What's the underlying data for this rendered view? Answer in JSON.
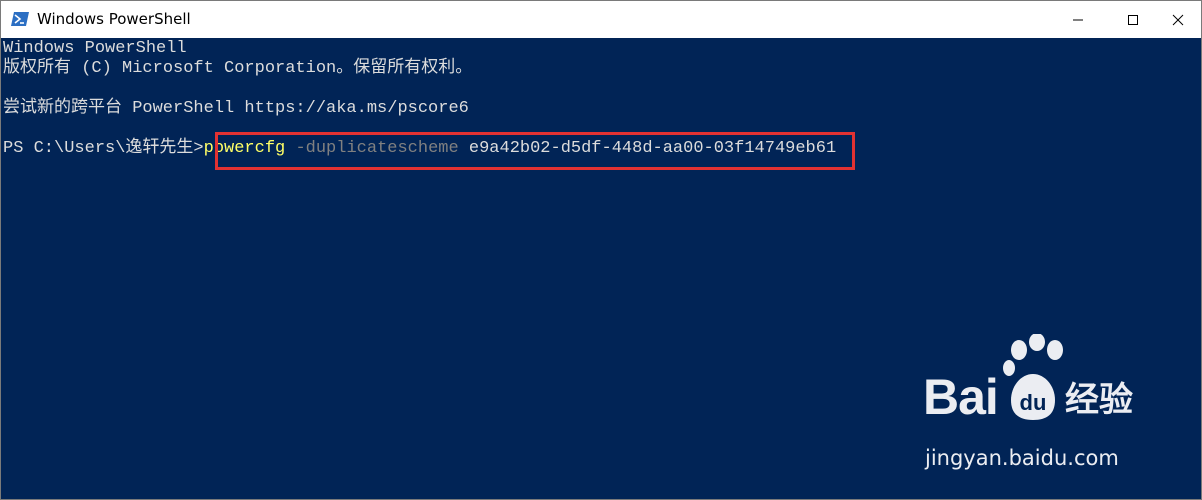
{
  "window": {
    "title": "Windows PowerShell",
    "icon": "powershell-icon"
  },
  "title_buttons": {
    "minimize": "minimize-icon",
    "maximize": "maximize-icon",
    "close": "close-icon"
  },
  "console": {
    "background_color": "#012456",
    "banner_line1": "Windows PowerShell",
    "banner_line2": "版权所有 (C) Microsoft Corporation。保留所有权利。",
    "banner_line3": "尝试新的跨平台 PowerShell https://aka.ms/pscore6",
    "prompt": "PS C:\\Users\\逸轩先生>",
    "command": {
      "name": "powercfg",
      "parameter": "-duplicatescheme",
      "argument": "e9a42b02-d5df-448d-aa00-03f14749eb61"
    }
  },
  "highlight": {
    "color": "#e23232"
  },
  "watermark": {
    "logo_text": "Bai",
    "logo_du": "du",
    "brand_cn": "经验",
    "url": "jingyan.baidu.com"
  }
}
